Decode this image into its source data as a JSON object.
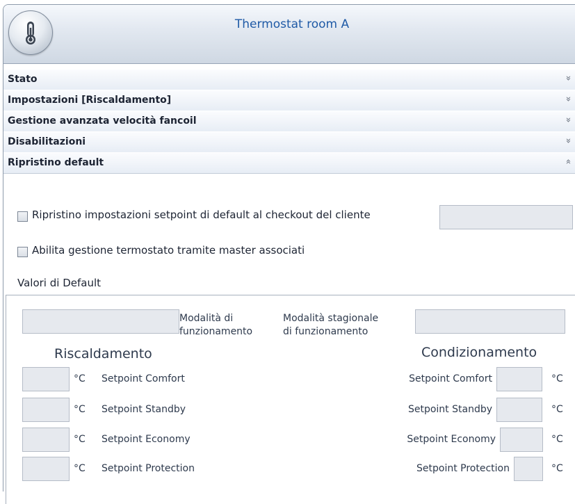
{
  "window": {
    "title": "Thermostat room A",
    "logo_icon": "thermometer-icon"
  },
  "sections": [
    {
      "label": "Stato",
      "state": "collapsed"
    },
    {
      "label": "Impostazioni [Riscaldamento]",
      "state": "collapsed"
    },
    {
      "label": "Gestione avanzata velocità fancoil",
      "state": "collapsed"
    },
    {
      "label": "Disabilitazioni",
      "state": "collapsed"
    },
    {
      "label": "Ripristino default",
      "state": "expanded"
    }
  ],
  "chevron_collapsed": "»",
  "chevron_expanded": "«",
  "options": {
    "reset_checkout": "Ripristino impostazioni setpoint di default al checkout del cliente",
    "enable_master": "Abilita gestione termostato tramite master associati"
  },
  "defaults": {
    "heading": "Valori di Default",
    "mode_label": "Modalità di\nfunzionamento",
    "seasonal_label": "Modalità stagionale\ndi funzionamento",
    "heating_title": "Riscaldamento",
    "cooling_title": "Condizionamento",
    "unit": "°C",
    "setpoints": [
      "Setpoint Comfort",
      "Setpoint Standby",
      "Setpoint Economy",
      "Setpoint Protection"
    ]
  }
}
